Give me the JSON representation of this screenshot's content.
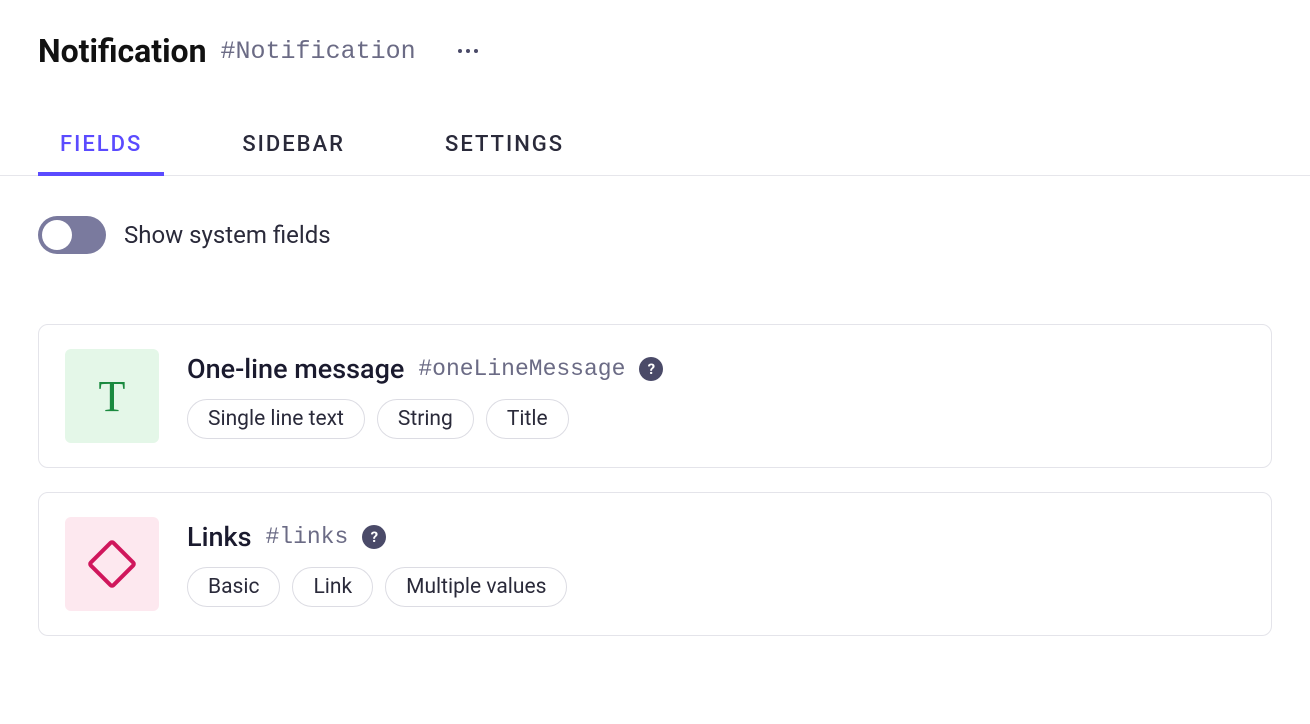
{
  "header": {
    "title": "Notification",
    "hash": "#Notification"
  },
  "tabs": [
    {
      "label": "FIELDS",
      "active": true
    },
    {
      "label": "SIDEBAR",
      "active": false
    },
    {
      "label": "SETTINGS",
      "active": false
    }
  ],
  "toggle": {
    "label": "Show system fields",
    "on": false
  },
  "fields": [
    {
      "iconType": "text",
      "iconGlyph": "T",
      "title": "One-line message",
      "hash": "#oneLineMessage",
      "chips": [
        "Single line text",
        "String",
        "Title"
      ]
    },
    {
      "iconType": "link",
      "iconGlyph": "",
      "title": "Links",
      "hash": "#links",
      "chips": [
        "Basic",
        "Link",
        "Multiple values"
      ]
    }
  ]
}
